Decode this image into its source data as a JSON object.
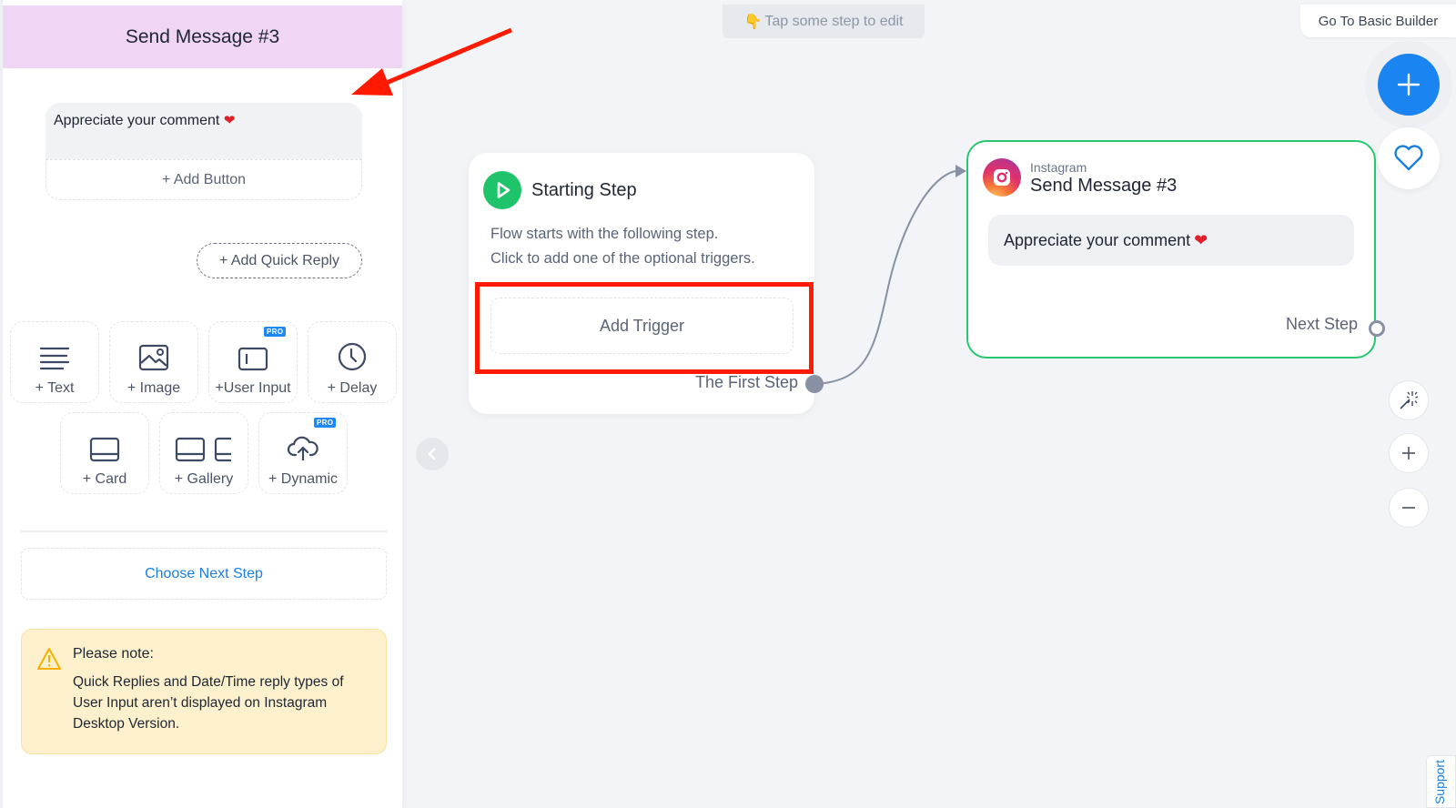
{
  "panel": {
    "header_title": "Send Message #3",
    "message_text": "Appreciate your comment",
    "message_emoji": "❤",
    "add_button_label": "+ Add Button",
    "add_quick_reply_label": "+ Add Quick Reply",
    "tiles": [
      {
        "label": "+ Text",
        "icon": "text-lines-icon",
        "pro": false
      },
      {
        "label": "+ Image",
        "icon": "image-icon",
        "pro": false
      },
      {
        "label": "+User Input",
        "icon": "input-field-icon",
        "pro": true
      },
      {
        "label": "+ Delay",
        "icon": "clock-icon",
        "pro": false
      },
      {
        "label": "+ Card",
        "icon": "card-icon",
        "pro": false
      },
      {
        "label": "+ Gallery",
        "icon": "gallery-icon",
        "pro": false
      },
      {
        "label": "+ Dynamic",
        "icon": "cloud-upload-icon",
        "pro": true
      }
    ],
    "pro_badge": "PRO",
    "choose_next_step_label": "Choose Next Step",
    "note": {
      "title": "Please note:",
      "body": "Quick Replies and Date/Time reply types of User Input aren’t displayed on Instagram Desktop Version."
    }
  },
  "canvas": {
    "hint_emoji": "👇",
    "hint_text": "Tap some step to edit",
    "basic_builder_label": "Go To Basic Builder",
    "support_label": "Support",
    "starting_step": {
      "title": "Starting Step",
      "desc_line1": "Flow starts with the following step.",
      "desc_line2": "Click to add one of the optional triggers.",
      "add_trigger_label": "Add Trigger",
      "output_label": "The First Step"
    },
    "instagram_step": {
      "platform": "Instagram",
      "title": "Send Message #3",
      "message_text": "Appreciate your comment",
      "message_emoji": "❤",
      "output_label": "Next Step",
      "border_color": "#28c76f"
    }
  },
  "colors": {
    "accent_blue": "#1a84f0",
    "highlight_red": "#ff1a00",
    "header_pink": "#f1d5f5",
    "start_green": "#1fc46a"
  }
}
